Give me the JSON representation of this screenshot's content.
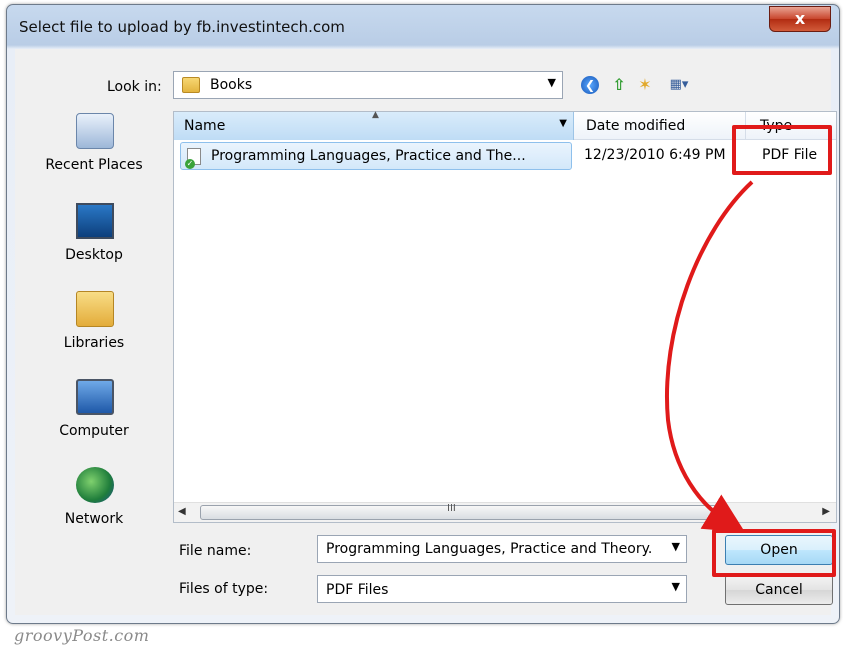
{
  "window": {
    "title": "Select file to upload by fb.investintech.com",
    "close_label": "x"
  },
  "look_in": {
    "label": "Look in:",
    "value": "Books"
  },
  "toolbar": {
    "back_glyph": "❮",
    "up_glyph": "⇧",
    "new_folder_glyph": "✶",
    "views_glyph": "▦▾"
  },
  "places": [
    {
      "label": "Recent Places",
      "icon": "recent-places-icon"
    },
    {
      "label": "Desktop",
      "icon": "desktop-icon"
    },
    {
      "label": "Libraries",
      "icon": "libraries-icon"
    },
    {
      "label": "Computer",
      "icon": "computer-icon"
    },
    {
      "label": "Network",
      "icon": "network-icon"
    }
  ],
  "file_list": {
    "columns": {
      "name": "Name",
      "date": "Date modified",
      "type": "Type"
    },
    "rows": [
      {
        "name": "Programming Languages, Practice and The...",
        "date": "12/23/2010 6:49 PM",
        "type": "PDF File"
      }
    ],
    "scroll_grip": "III"
  },
  "file_name": {
    "label": "File name:",
    "value": "Programming Languages, Practice and Theory."
  },
  "file_type": {
    "label": "Files of type:",
    "value": "PDF Files"
  },
  "buttons": {
    "open": "Open",
    "cancel": "Cancel"
  },
  "watermark": "groovyPost.com",
  "colors": {
    "annotation": "#e01a1a",
    "selection": "#d3e8fa",
    "title_bar": "#c7d9ee"
  }
}
